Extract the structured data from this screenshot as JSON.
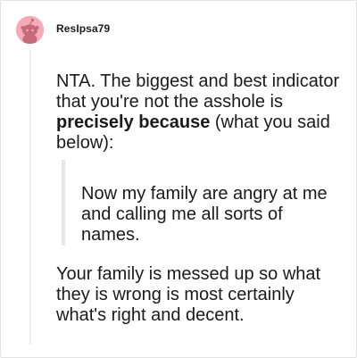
{
  "comment": {
    "username": "ResIpsa79",
    "avatar_icon": "reddit-snoo-avatar-icon",
    "avatar_color": "#f6a9b6",
    "para1_plain": "NTA. The biggest and best indicator that you're not the asshole is ",
    "para1_bold": "precisely because",
    "para1_tail": " (what you said below):",
    "quote": "Now my family are angry at me and calling me all sorts of names.",
    "para2": "Your family is messed up so what they is wrong is most certainly what's right and decent."
  }
}
